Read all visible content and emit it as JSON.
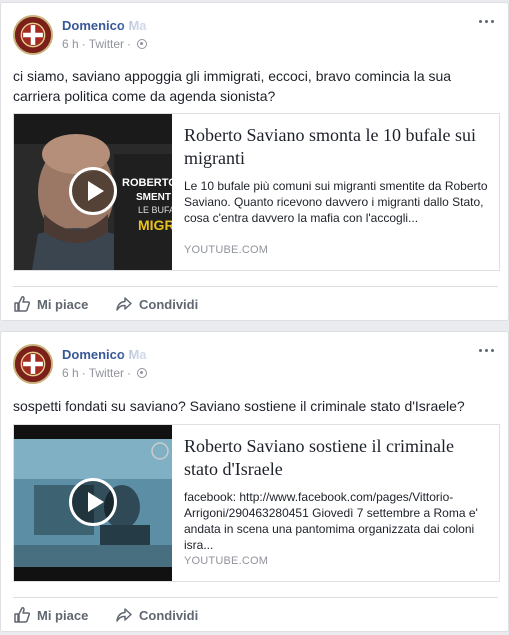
{
  "posts": [
    {
      "author": "Domenico Ma",
      "time": "6 h",
      "source": "Twitter",
      "text": "ci siamo, saviano appoggia gli immigrati, eccoci, bravo comincia la sua carriera politica come da agenda sionista?",
      "link": {
        "title": "Roberto Saviano smonta le 10 bufale sui migranti",
        "description": "Le 10 bufale più comuni sui migranti smentite da Roberto Saviano. Quanto ricevono davvero i migranti dallo Stato, cosa c'entra davvero la mafia con l'accogli...",
        "domain": "YOUTUBE.COM",
        "thumb_text": [
          "ROBERTO S",
          "SMENT",
          "LE BUFAL",
          "MIGRA"
        ]
      },
      "actions": {
        "like": "Mi piace",
        "share": "Condividi"
      }
    },
    {
      "author": "Domenico Ma",
      "time": "6 h",
      "source": "Twitter",
      "text": "sospetti fondati su saviano? Saviano sostiene il criminale stato d'Israele?",
      "link": {
        "title": "Roberto Saviano sostiene il criminale stato d'Israele",
        "description": "facebook: http://www.facebook.com/pages/Vittorio-Arrigoni/290463280451 Giovedì 7 settembre a Roma e' andata in scena una pantomima organizzata dai coloni isra...",
        "domain": "YOUTUBE.COM"
      },
      "actions": {
        "like": "Mi piace",
        "share": "Condividi"
      }
    }
  ],
  "icons": {
    "avatar": "crest-cross-icon",
    "more": "more-dots-icon",
    "privacy": "globe-icon",
    "play": "play-icon",
    "like": "thumbs-up-icon",
    "share": "share-arrow-icon"
  },
  "colors": {
    "link": "#365899",
    "muted": "#90949c",
    "action": "#606770",
    "background": "#e9ebee"
  }
}
